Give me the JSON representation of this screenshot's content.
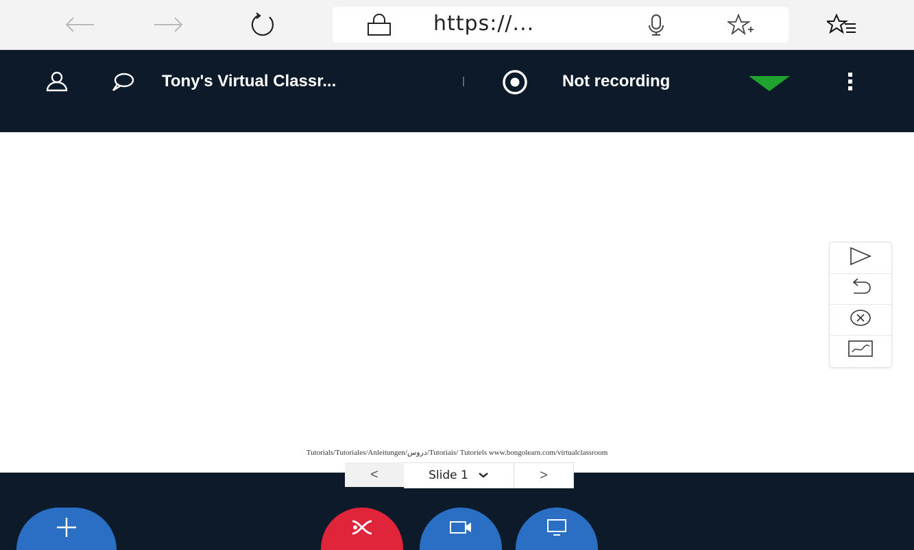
{
  "browser": {
    "url": "https://...",
    "icons": [
      "back-arrow-icon",
      "forward-arrow-icon",
      "refresh-icon",
      "lock-icon",
      "microphone-icon",
      "add-favorite-icon",
      "favorites-icon"
    ]
  },
  "header": {
    "classroom_title": "Tony's Virtual Classr...",
    "recording_status": "Not recording",
    "connection_color": "#1fa22e",
    "icons": [
      "user-icon",
      "chat-icon",
      "record-icon",
      "signal-icon",
      "more-options-icon"
    ]
  },
  "stage": {
    "footer_text": "Tutorials/Tutoriales/Anleitungen/دروس/Tutoriais/ Tutoriels www.bongolearn.com/virtualclassroom"
  },
  "tools": [
    "pointer-icon",
    "undo-icon",
    "clear-icon",
    "draw-icon"
  ],
  "slide_nav": {
    "prev": "<",
    "current": "Slide 1",
    "next": ">"
  },
  "actions": {
    "add_color": "#2a6fc4",
    "mute_color": "#e0243a",
    "video_color": "#2a6fc4",
    "screen_color": "#2a6fc4"
  }
}
